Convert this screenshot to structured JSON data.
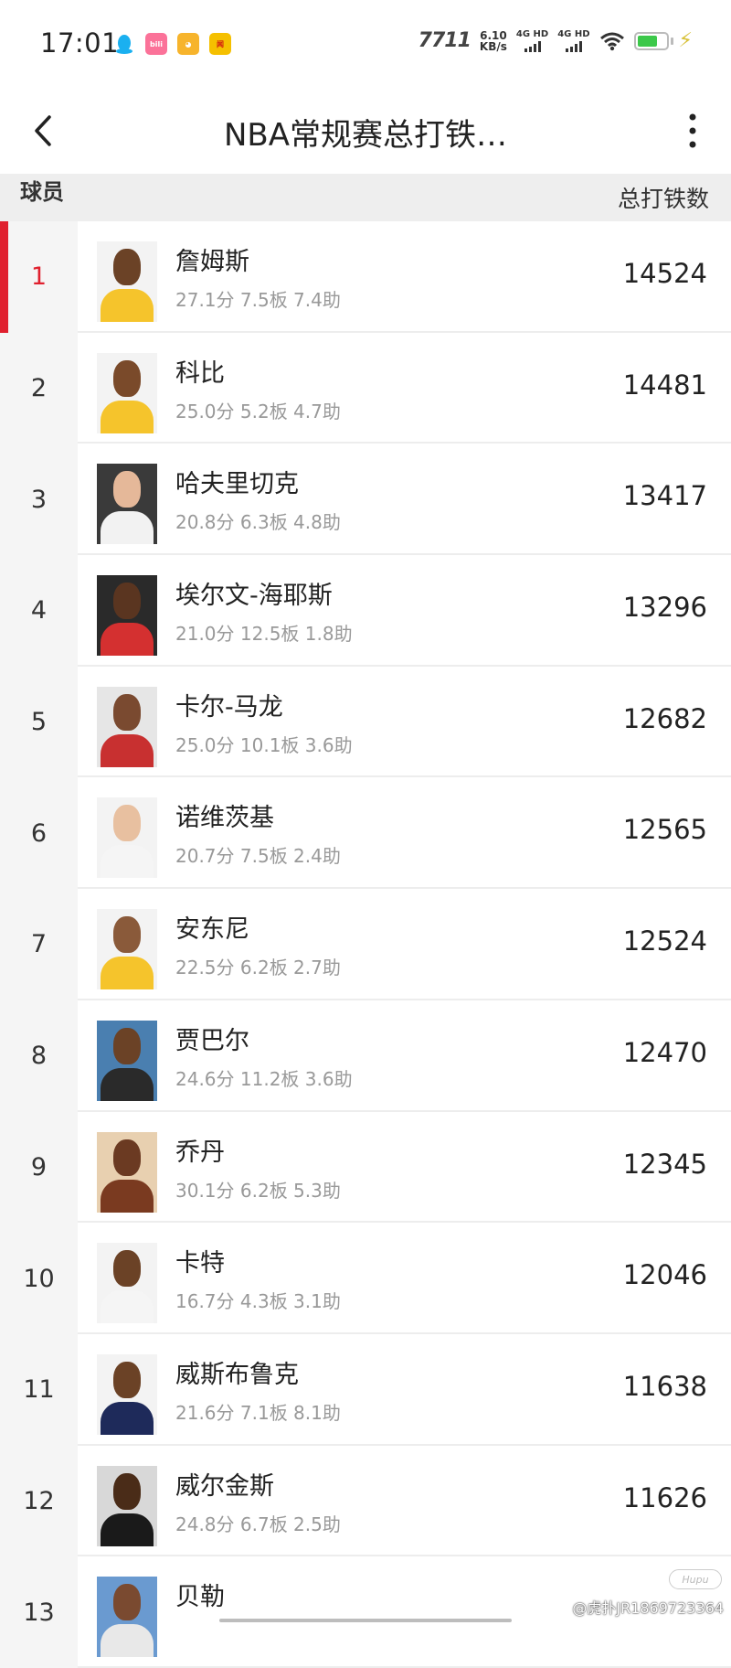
{
  "status_bar": {
    "time": "17:01",
    "net_speed_value": "6.10",
    "net_speed_unit": "KB/s",
    "sim1_label": "4G HD",
    "sim2_label": "4G HD",
    "carrier_logo": "7711",
    "app_icons": [
      "qq-icon",
      "bilibili-icon",
      "baidu-icon",
      "news-icon"
    ],
    "battery_icon": "battery-icon",
    "charging_icon": "bolt-icon"
  },
  "header": {
    "title": "NBA常规赛总打铁…",
    "back_icon": "chevron-left-icon",
    "more_icon": "more-vertical-icon"
  },
  "columns": {
    "player": "球员",
    "stat": "总打铁数"
  },
  "accent_color": "#e0202e",
  "rows": [
    {
      "rank": "1",
      "name": "詹姆斯",
      "stats": "27.1分  7.5板  7.4助",
      "value": "14524",
      "jersey": "#f5c42c",
      "skin": "#6b4226",
      "bg": "#f3f3f3"
    },
    {
      "rank": "2",
      "name": "科比",
      "stats": "25.0分  5.2板  4.7助",
      "value": "14481",
      "jersey": "#f5c42c",
      "skin": "#7a4a2a",
      "bg": "#f3f3f3"
    },
    {
      "rank": "3",
      "name": "哈夫里切克",
      "stats": "20.8分  6.3板  4.8助",
      "value": "13417",
      "jersey": "#f2f2f2",
      "skin": "#e5b899",
      "bg": "#3a3a3a"
    },
    {
      "rank": "4",
      "name": "埃尔文-海耶斯",
      "stats": "21.0分  12.5板  1.8助",
      "value": "13296",
      "jersey": "#d43030",
      "skin": "#5a3520",
      "bg": "#2a2a2a"
    },
    {
      "rank": "5",
      "name": "卡尔-马龙",
      "stats": "25.0分  10.1板  3.6助",
      "value": "12682",
      "jersey": "#c83030",
      "skin": "#7a4a30",
      "bg": "#e6e6e6"
    },
    {
      "rank": "6",
      "name": "诺维茨基",
      "stats": "20.7分  7.5板  2.4助",
      "value": "12565",
      "jersey": "#f5f5f5",
      "skin": "#e8c0a0",
      "bg": "#f3f3f3"
    },
    {
      "rank": "7",
      "name": "安东尼",
      "stats": "22.5分  6.2板  2.7助",
      "value": "12524",
      "jersey": "#f5c42c",
      "skin": "#8a5a3a",
      "bg": "#f3f3f3"
    },
    {
      "rank": "8",
      "name": "贾巴尔",
      "stats": "24.6分  11.2板  3.6助",
      "value": "12470",
      "jersey": "#2a2a2a",
      "skin": "#6b4226",
      "bg": "#4a7fb0"
    },
    {
      "rank": "9",
      "name": "乔丹",
      "stats": "30.1分  6.2板  5.3助",
      "value": "12345",
      "jersey": "#7a3a20",
      "skin": "#6b3a22",
      "bg": "#e8d0b0"
    },
    {
      "rank": "10",
      "name": "卡特",
      "stats": "16.7分  4.3板  3.1助",
      "value": "12046",
      "jersey": "#f5f5f5",
      "skin": "#6b4226",
      "bg": "#f3f3f3"
    },
    {
      "rank": "11",
      "name": "威斯布鲁克",
      "stats": "21.6分  7.1板  8.1助",
      "value": "11638",
      "jersey": "#1e2a5a",
      "skin": "#6b4226",
      "bg": "#f3f3f3"
    },
    {
      "rank": "12",
      "name": "威尔金斯",
      "stats": "24.8分  6.7板  2.5助",
      "value": "11626",
      "jersey": "#1a1a1a",
      "skin": "#4a2c18",
      "bg": "#d8d8d8"
    },
    {
      "rank": "13",
      "name": "贝勒",
      "stats": "",
      "value": "",
      "jersey": "#e8e8e8",
      "skin": "#7a4a30",
      "bg": "#6a9ad0"
    }
  ],
  "watermark": "@虎扑JR1869723364",
  "watermark_logo": "Hupu"
}
